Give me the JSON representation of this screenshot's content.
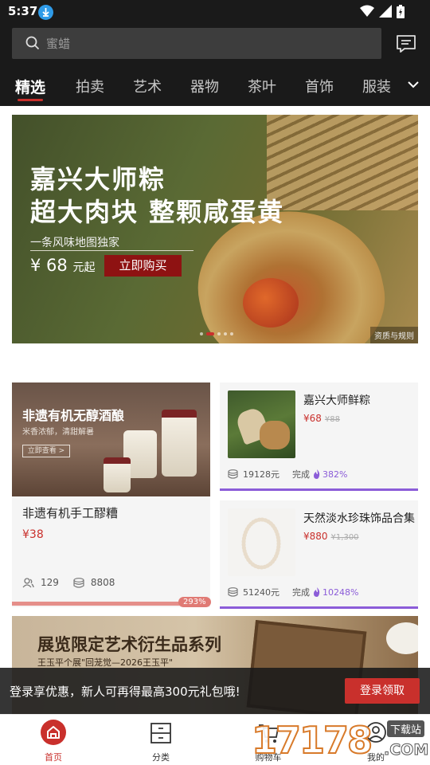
{
  "status_bar": {
    "time": "5:37"
  },
  "search": {
    "placeholder": "蜜蜡"
  },
  "tabs": [
    {
      "label": "精选",
      "active": true
    },
    {
      "label": "拍卖"
    },
    {
      "label": "艺术"
    },
    {
      "label": "器物"
    },
    {
      "label": "茶叶"
    },
    {
      "label": "首饰"
    },
    {
      "label": "服装"
    }
  ],
  "banner": {
    "title_line1": "嘉兴大师粽",
    "title_line2": "超大肉块 整颗咸蛋黄",
    "subtitle": "一条风味地图独家",
    "price": "¥ 68",
    "price_suffix": "元起",
    "buy_label": "立即购买",
    "qualification": "资质与规则"
  },
  "left_card": {
    "image_title": "非遗有机无醇酒酿",
    "image_subtitle": "米香浓郁，清甜解暑",
    "image_button": "立即查看 >",
    "title": "非遗有机手工醪糟",
    "price": "¥38",
    "participants": "129",
    "amount": "8808",
    "progress_percent": 293,
    "progress_label": "293%"
  },
  "right_cards": [
    {
      "title": "嘉兴大师鲜粽",
      "price": "¥68",
      "original_price": "¥88",
      "amount": "19128元",
      "done_label": "完成",
      "percent": "382%"
    },
    {
      "title": "天然淡水珍珠饰品合集",
      "price": "¥880",
      "original_price": "¥1,300",
      "amount": "51240元",
      "done_label": "完成",
      "percent": "10248%"
    }
  ],
  "banner2": {
    "title": "展览限定艺术衍生品系列",
    "subtitle": "王玉平个展\"回茏觉—2026王玉平\""
  },
  "login_prompt": {
    "text": "登录享优惠，新人可再得最高300元礼包哦!",
    "button": "登录领取"
  },
  "bottom_nav": [
    {
      "label": "首页",
      "active": true
    },
    {
      "label": "分类"
    },
    {
      "label": "购物车"
    },
    {
      "label": "我的"
    }
  ],
  "watermark": {
    "number": "17178",
    "suffix": ".COM",
    "badge": "下载站"
  },
  "colors": {
    "accent": "#c9302c",
    "purple": "#8b5cd8",
    "dark": "#1a1a1a"
  }
}
